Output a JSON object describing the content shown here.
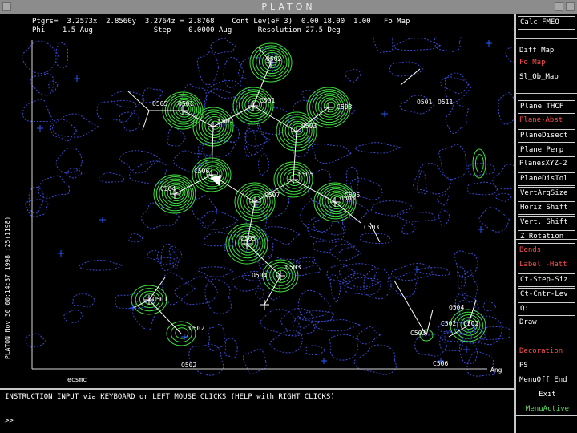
{
  "window": {
    "title": "PLATON"
  },
  "info": {
    "line1": "Ptgrs=  3.2573x  2.8560y  3.2764z = 2.8768    Cont Lev(eF 3)  0.00 18.00  1.00   Fo Map",
    "line2": "Phi    1.5 Aug              Step    0.0000 Aug      Resolution 27.5 Deg"
  },
  "plot": {
    "vertical_caption": "PLATON Nov 30 00:14:37 1998   :25(1198)",
    "bottom_left_label": "ecsmc",
    "bottom_right_label": "Ang",
    "atom_labels": [
      "O502",
      "O501",
      "C501",
      "C502",
      "C503",
      "O503",
      "C506",
      "C504",
      "C505",
      "C507",
      "O505",
      "C505",
      "C503",
      "C501",
      "O502",
      "O511",
      "C503",
      "O504",
      "C502",
      "C503",
      "C502",
      "C506",
      "O505",
      "O501",
      "C505",
      "O502",
      "O504"
    ],
    "colors": {
      "contour": "#3fe03f",
      "noise": "#3a4ad4",
      "bond": "#ffffff",
      "cross": "#2a5aff"
    }
  },
  "sidebar": {
    "items": [
      {
        "label": "Calc FMEO",
        "color": "#ffffff"
      },
      {
        "label": "Diff Map",
        "color": "#ffffff"
      },
      {
        "label": "Fo Map",
        "color": "#ff4d4d"
      },
      {
        "label": "Sl_Ob_Map",
        "color": "#ffffff"
      },
      {
        "label": "Plane THCF",
        "color": "#ffffff"
      },
      {
        "label": "Plane-Abst",
        "color": "#ff4d4d"
      },
      {
        "label": "PlaneDisect",
        "color": "#ffffff"
      },
      {
        "label": "Plane Perp",
        "color": "#ffffff"
      },
      {
        "label": "PlanesXYZ-2",
        "color": "#ffffff"
      },
      {
        "label": "PlaneDisTol",
        "color": "#ffffff"
      },
      {
        "label": "VertArgSize",
        "color": "#ffffff"
      },
      {
        "label": "Horiz Shift",
        "color": "#ffffff"
      },
      {
        "label": "Vert. Shift",
        "color": "#ffffff"
      },
      {
        "label": "Z Rotation",
        "color": "#ffffff"
      },
      {
        "label": "Bonds",
        "color": "#ff4d4d"
      },
      {
        "label": "Label -Hatt",
        "color": "#ff4d4d"
      },
      {
        "label": "Ct-Step-Siz",
        "color": "#ffffff"
      },
      {
        "label": "Ct-Cntr-Lev",
        "color": "#ffffff"
      },
      {
        "label": "Q:",
        "color": "#ffffff"
      },
      {
        "label": "Draw",
        "color": "#ffffff"
      },
      {
        "label": "Decoration",
        "color": "#ff4d4d"
      },
      {
        "label": "PS",
        "color": "#ffffff"
      },
      {
        "label": "MenuOff End",
        "color": "#ffffff"
      },
      {
        "label": "Exit",
        "color": "#ffffff"
      },
      {
        "label": "MenuActive",
        "color": "#5fe05f"
      }
    ]
  },
  "command": {
    "instruction": "INSTRUCTION INPUT via KEYBOARD or LEFT MOUSE CLICKS (HELP with RIGHT CLICKS)",
    "prompt": ">>"
  }
}
